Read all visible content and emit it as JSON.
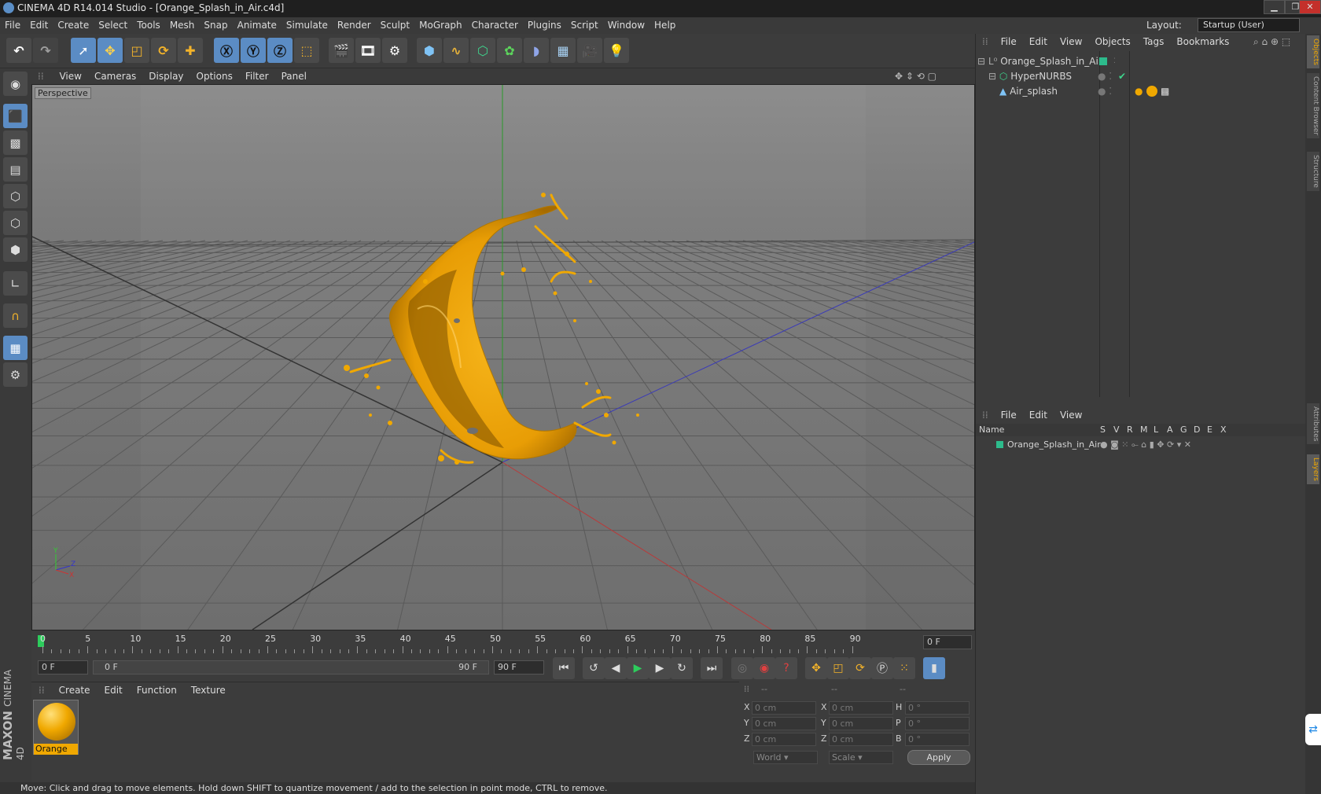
{
  "window": {
    "title": "CINEMA 4D R14.014 Studio - [Orange_Splash_in_Air.c4d]"
  },
  "menu": [
    "File",
    "Edit",
    "Create",
    "Select",
    "Tools",
    "Mesh",
    "Snap",
    "Animate",
    "Simulate",
    "Render",
    "Sculpt",
    "MoGraph",
    "Character",
    "Plugins",
    "Script",
    "Window",
    "Help"
  ],
  "layout": {
    "label": "Layout:",
    "value": "Startup (User)"
  },
  "viewport": {
    "menu": [
      "View",
      "Cameras",
      "Display",
      "Options",
      "Filter",
      "Panel"
    ],
    "label": "Perspective"
  },
  "timeline": {
    "ticks": [
      "0",
      "5",
      "10",
      "15",
      "20",
      "25",
      "30",
      "35",
      "40",
      "45",
      "50",
      "55",
      "60",
      "65",
      "70",
      "75",
      "80",
      "85",
      "90"
    ],
    "current_frame": "0 F"
  },
  "anim": {
    "start": "0 F",
    "range_start": "0 F",
    "range_end": "90 F",
    "end": "90 F"
  },
  "materials": {
    "menu": [
      "Create",
      "Edit",
      "Function",
      "Texture"
    ],
    "items": [
      {
        "name": "Orange"
      }
    ]
  },
  "coords": {
    "headers": [
      "--",
      "--",
      "--"
    ],
    "rows": [
      {
        "a": "X",
        "av": "0 cm",
        "b": "X",
        "bv": "0 cm",
        "c": "H",
        "cv": "0 °"
      },
      {
        "a": "Y",
        "av": "0 cm",
        "b": "Y",
        "bv": "0 cm",
        "c": "P",
        "cv": "0 °"
      },
      {
        "a": "Z",
        "av": "0 cm",
        "b": "Z",
        "bv": "0 cm",
        "c": "B",
        "cv": "0 °"
      }
    ],
    "mode1": "World",
    "mode2": "Scale",
    "apply": "Apply"
  },
  "objects": {
    "menu": [
      "File",
      "Edit",
      "View",
      "Objects",
      "Tags",
      "Bookmarks"
    ],
    "items": [
      "Orange_Splash_in_Air",
      "HyperNURBS",
      "Air_splash"
    ]
  },
  "layers": {
    "menu": [
      "File",
      "Edit",
      "View"
    ],
    "columns": [
      "Name",
      "S",
      "V",
      "R",
      "M",
      "L",
      "A",
      "G",
      "D",
      "E",
      "X"
    ],
    "items": [
      "Orange_Splash_in_Air"
    ]
  },
  "side_tabs": [
    "Objects",
    "Content Browser",
    "Structure",
    "Attributes",
    "Layers"
  ],
  "branding": {
    "line1": "MAXON",
    "line2": "CINEMA 4D"
  },
  "status": "Move: Click and drag to move elements. Hold down SHIFT to quantize movement / add to the selection in point mode, CTRL to remove.",
  "colors": {
    "accent": "#5b8cc4",
    "splash": "#f0a800",
    "layer": "#2dbb8c"
  }
}
